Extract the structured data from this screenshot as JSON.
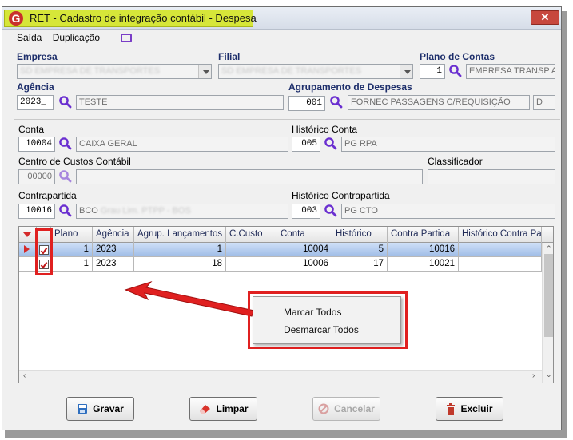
{
  "window": {
    "title": "RET - Cadastro de integração contábil - Despesa",
    "close_label": "✕"
  },
  "menu": {
    "saida": "Saída",
    "duplicacao": "Duplicação"
  },
  "form": {
    "empresa_label": "Empresa",
    "filial_label": "Filial",
    "plano_label": "Plano de Contas",
    "plano_value": "1",
    "plano_desc": "EMPRESA TRANSP A",
    "agencia_label": "Agência",
    "agencia_value": "2023_",
    "agencia_desc": "TESTE",
    "agrup_label": "Agrupamento de Despesas",
    "agrup_value": "001",
    "agrup_desc": "FORNEC PASSAGENS C/REQUISIÇÃO",
    "agrup_extra": "D",
    "conta_label": "Conta",
    "conta_value": "10004",
    "conta_desc": "CAIXA GERAL",
    "hist_conta_label": "Histórico Conta",
    "hist_conta_value": "005",
    "hist_conta_desc": "PG RPA",
    "ccusto_label": "Centro de Custos Contábil",
    "ccusto_value": "00000",
    "classificador_label": "Classificador",
    "contrapartida_label": "Contrapartida",
    "contrapartida_value": "10016",
    "contrapartida_desc": "BCO",
    "hist_contra_label": "Histórico Contrapartida",
    "hist_contra_value": "003",
    "hist_contra_desc": "PG CTO"
  },
  "grid": {
    "columns": [
      "Plano",
      "Agência",
      "Agrup. Lançamentos",
      "C.Custo",
      "Conta",
      "Histórico",
      "Contra Partida",
      "Histórico Contra Parti"
    ],
    "rows": [
      {
        "plano": "1",
        "agencia": "2023",
        "agrup": "1",
        "ccusto": "",
        "conta": "10004",
        "historico": "5",
        "contra": "10016",
        "hist_contra": ""
      },
      {
        "plano": "1",
        "agencia": "2023",
        "agrup": "18",
        "ccusto": "",
        "conta": "10006",
        "historico": "17",
        "contra": "10021",
        "hist_contra": ""
      }
    ]
  },
  "context_menu": {
    "item1": "Marcar Todos",
    "item2": "Desmarcar Todos"
  },
  "buttons": {
    "gravar": "Gravar",
    "limpar": "Limpar",
    "cancelar": "Cancelar",
    "excluir": "Excluir"
  },
  "colors": {
    "highlight": "#d6e639",
    "annotation_red": "#e02020",
    "label_blue": "#1d2e6b",
    "lens_purple": "#6a2fd0"
  },
  "icons": [
    "app-logo-icon",
    "close-icon",
    "screen-icon",
    "search-icon",
    "dropdown-icon",
    "save-icon",
    "eraser-icon",
    "cancel-icon",
    "trash-icon",
    "checkbox-icon"
  ]
}
